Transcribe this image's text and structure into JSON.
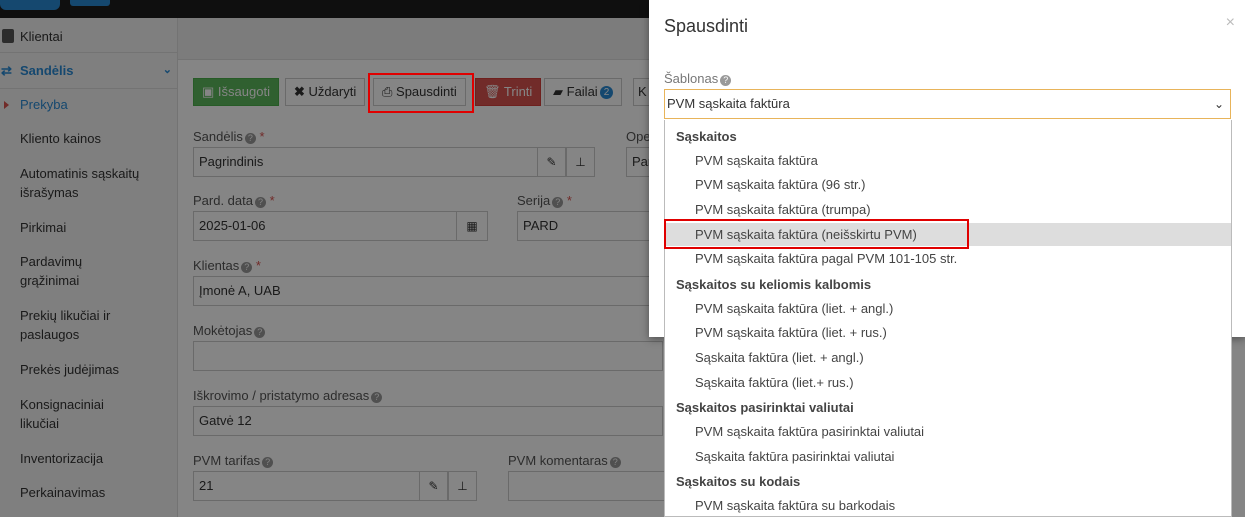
{
  "sidebar": {
    "klientai": "Klientai",
    "sandelis": "Sandėlis",
    "items": [
      "Prekyba",
      "Kliento kainos",
      "Automatinis sąskaitų",
      "išrašymas",
      "Pirkimai",
      "Pardavimų",
      "grąžinimai",
      "Prekių likučiai ir",
      "paslaugos",
      "Prekės judėjimas",
      "Konsignaciniai",
      "likučiai",
      "Inventorizacija",
      "Perkainavimas"
    ]
  },
  "toolbar": {
    "save": "Išsaugoti",
    "close": "Uždaryti",
    "print": "Spausdinti",
    "delete": "Trinti",
    "files": "Failai",
    "files_count": "2",
    "more": "K"
  },
  "form": {
    "sandelis_label": "Sandėlis",
    "sandelis_value": "Pagrindinis",
    "ope_label": "Ope",
    "ope_value": "Par",
    "pard_data_label": "Pard. data",
    "pard_data_value": "2025-01-06",
    "serija_label": "Serija",
    "serija_value": "PARD",
    "klientas_label": "Klientas",
    "klientas_value": "Įmonė A, UAB",
    "moketojas_label": "Mokėtojas",
    "adresas_label": "Iškrovimo / pristatymo adresas",
    "adresas_value": "Gatvė 12",
    "pvm_tarifas_label": "PVM tarifas",
    "pvm_tarifas_value": "21",
    "pvm_komentaras_label": "PVM komentaras",
    "required_mark": "*",
    "help_mark": "?"
  },
  "modal": {
    "title": "Spausdinti",
    "close": "×",
    "template_label": "Šablonas",
    "selected": "PVM sąskaita faktūra"
  },
  "dropdown": {
    "group1": "Sąskaitos",
    "opt1": "PVM sąskaita faktūra",
    "opt2": "PVM sąskaita faktūra (96 str.)",
    "opt3": "PVM sąskaita faktūra (trumpa)",
    "opt4": "PVM sąskaita faktūra (neišskirtu PVM)",
    "opt5": "PVM sąskaita faktūra pagal PVM 101-105 str.",
    "group2": "Sąskaitos su keliomis kalbomis",
    "opt6": "PVM sąskaita faktūra (liet. + angl.)",
    "opt7": "PVM sąskaita faktūra (liet. + rus.)",
    "opt8": "Sąskaita faktūra (liet. + angl.)",
    "opt9": "Sąskaita faktūra (liet.+ rus.)",
    "group3": "Sąskaitos pasirinktai valiutai",
    "opt10": "PVM sąskaita faktūra pasirinktai valiutai",
    "opt11": "Sąskaita faktūra pasirinktai valiutai",
    "group4": "Sąskaitos su kodais",
    "opt12": "PVM sąskaita faktūra su barkodais"
  },
  "colors": {
    "highlight": "#e00000",
    "accent": "#2a8bd5",
    "save_green": "#5cb85c",
    "delete_red": "#d9534f"
  }
}
